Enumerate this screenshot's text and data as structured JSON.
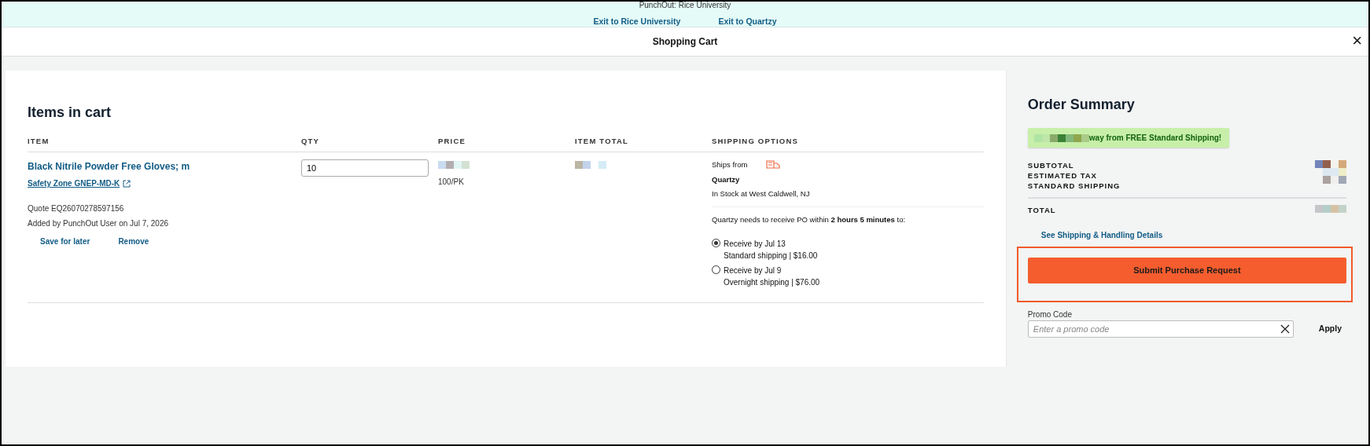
{
  "banner": {
    "title": "PunchOut: Rice University",
    "links": [
      "Exit to Rice University",
      "Exit to Quartzy"
    ]
  },
  "header": {
    "title": "Shopping Cart",
    "close": "×"
  },
  "cart": {
    "title": "Items in cart",
    "columns": [
      "ITEM",
      "QTY",
      "PRICE",
      "ITEM TOTAL",
      "SHIPPING OPTIONS"
    ],
    "items": [
      {
        "name": "Black Nitrile Powder Free Gloves; m",
        "sku_link": "Safety Zone GNEP-MD-K",
        "quote": "Quote EQ26070278597156",
        "added": "Added by PunchOut User on Jul 7, 2026",
        "actions": [
          "Save for later",
          "Remove"
        ],
        "quantity": "10",
        "unit": "100/PK",
        "shipping": {
          "ships_from_label": "Ships from",
          "vendor": "Quartzy",
          "stock": "In Stock at West Caldwell, NJ",
          "deadline": "Quartzy needs to receive PO within **2 hours 5 minutes** to:",
          "options": [
            {
              "title": "Receive by Jul 13",
              "detail": "Standard shipping | $16.00",
              "selected": true
            },
            {
              "title": "Receive by Jul 9",
              "detail": "Overnight shipping | $76.00",
              "selected": false
            }
          ]
        }
      }
    ]
  },
  "summary": {
    "title": "Order Summary",
    "free_shipping_note": "way from FREE Standard Shipping!",
    "lines": [
      "SUBTOTAL",
      "ESTIMATED TAX",
      "STANDARD SHIPPING"
    ],
    "total_label": "TOTAL",
    "details_link": "See Shipping & Handling Details",
    "submit": "Submit Purchase Request",
    "submit_highlighted": true,
    "promo": {
      "label": "Promo Code",
      "placeholder": "Enter a promo code",
      "apply": "Apply"
    }
  }
}
